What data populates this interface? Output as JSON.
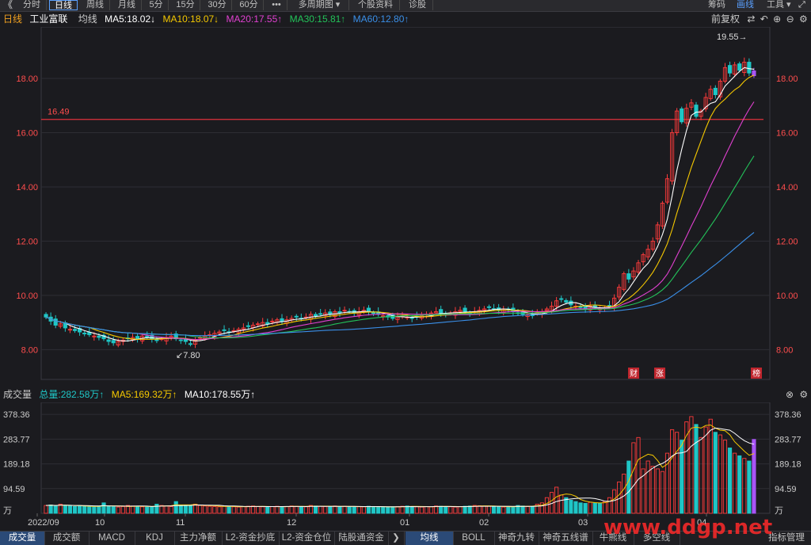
{
  "toolbar": {
    "back_glyph": "《",
    "periods": [
      "分时",
      "日线",
      "周线",
      "月线",
      "5分",
      "15分",
      "30分",
      "60分",
      "•••",
      "多周期图 ▾",
      "个股资料",
      "诊股"
    ],
    "active_period": "日线",
    "right_items": [
      "筹码",
      "画线",
      "工具 ▾"
    ],
    "icons": [
      "expand-icon"
    ]
  },
  "legend": {
    "period": "日线",
    "stock_name": "工业富联",
    "ma_label": "均线",
    "ma5": "MA5:18.02↓",
    "ma10": "MA10:18.07↓",
    "ma20": "MA20:17.55↑",
    "ma30": "MA30:15.81↑",
    "ma60": "MA60:12.80↑",
    "adjust": "前复权",
    "icons": [
      "swap-icon",
      "undo-icon",
      "zoom-in-icon",
      "zoom-out-icon",
      "settings-icon"
    ]
  },
  "volume_legend": {
    "title": "成交量",
    "total": "总量:282.58万↑",
    "ma5": "MA5:169.32万↑",
    "ma10": "MA10:178.55万↑"
  },
  "colors": {
    "up": "#ff3b3b",
    "down": "#1fc6c6",
    "ma5": "#ffffff",
    "ma10": "#f5c800",
    "ma20": "#e040d0",
    "ma30": "#23c35a",
    "ma60": "#3a8fe8",
    "last_bar": "#a855f7"
  },
  "chart_data": [
    {
      "type": "candlestick",
      "title": "工业富联 日线",
      "yticks": [
        "8.00",
        "10.00",
        "12.00",
        "14.00",
        "16.00",
        "18.00"
      ],
      "ylim": [
        6.9,
        19.9
      ],
      "xticks": [
        "2022/09",
        "10",
        "11",
        "12",
        "01",
        "02",
        "03",
        "04"
      ],
      "reference_line": {
        "label": "16.49",
        "value": 16.49
      },
      "annotations": [
        {
          "text": "19.55",
          "value": 19.55
        },
        {
          "text": "7.80",
          "value": 7.8
        }
      ],
      "badges": [
        "财",
        "涨",
        "榜"
      ],
      "n_bars": 148,
      "close": [
        9.2,
        9.05,
        8.9,
        8.95,
        8.8,
        8.75,
        8.7,
        8.65,
        8.6,
        8.55,
        8.5,
        8.45,
        8.4,
        8.3,
        8.25,
        8.3,
        8.35,
        8.4,
        8.45,
        8.4,
        8.5,
        8.45,
        8.4,
        8.35,
        8.4,
        8.45,
        8.5,
        8.4,
        8.35,
        8.3,
        8.2,
        8.35,
        8.45,
        8.5,
        8.55,
        8.6,
        8.65,
        8.7,
        8.65,
        8.7,
        8.75,
        8.8,
        8.85,
        8.9,
        8.95,
        9.0,
        8.95,
        9.05,
        9.1,
        9.05,
        9.1,
        9.15,
        9.2,
        9.15,
        9.2,
        9.3,
        9.25,
        9.3,
        9.35,
        9.3,
        9.4,
        9.35,
        9.45,
        9.4,
        9.35,
        9.4,
        9.45,
        9.4,
        9.35,
        9.3,
        9.25,
        9.2,
        9.15,
        9.2,
        9.25,
        9.2,
        9.15,
        9.2,
        9.25,
        9.3,
        9.35,
        9.4,
        9.35,
        9.3,
        9.35,
        9.4,
        9.45,
        9.4,
        9.35,
        9.4,
        9.45,
        9.5,
        9.55,
        9.5,
        9.45,
        9.5,
        9.45,
        9.4,
        9.35,
        9.3,
        9.3,
        9.25,
        9.35,
        9.4,
        9.5,
        9.6,
        9.8,
        9.85,
        9.75,
        9.65,
        9.6,
        9.55,
        9.5,
        9.6,
        9.55,
        9.5,
        9.55,
        9.6,
        9.9,
        10.3,
        10.8,
        10.6,
        10.9,
        11.2,
        11.5,
        11.7,
        12.0,
        12.6,
        13.4,
        14.3,
        16.0,
        16.8,
        16.4,
        16.9,
        17.1,
        16.6,
        16.8,
        17.3,
        17.6,
        17.4,
        17.9,
        18.4,
        18.2,
        18.5,
        18.3,
        18.6,
        18.2,
        18.1
      ],
      "volume_ylim": [
        0,
        400
      ],
      "volume_yticks": [
        "378.36",
        "283.77",
        "189.18",
        "94.59",
        "万"
      ],
      "volume": [
        30,
        32,
        28,
        35,
        30,
        28,
        26,
        30,
        27,
        25,
        24,
        28,
        40,
        26,
        25,
        24,
        26,
        30,
        28,
        27,
        25,
        24,
        26,
        35,
        30,
        28,
        26,
        45,
        32,
        30,
        28,
        35,
        30,
        28,
        27,
        26,
        25,
        28,
        26,
        25,
        24,
        26,
        27,
        28,
        26,
        25,
        24,
        26,
        27,
        25,
        26,
        28,
        27,
        26,
        25,
        30,
        28,
        27,
        26,
        25,
        28,
        26,
        27,
        25,
        24,
        26,
        25,
        27,
        26,
        25,
        24,
        23,
        25,
        26,
        27,
        28,
        26,
        25,
        24,
        26,
        25,
        28,
        27,
        26,
        25,
        24,
        26,
        27,
        28,
        30,
        29,
        28,
        27,
        26,
        25,
        24,
        26,
        25,
        30,
        28,
        26,
        27,
        35,
        40,
        60,
        80,
        100,
        70,
        60,
        50,
        45,
        40,
        38,
        42,
        40,
        38,
        45,
        60,
        90,
        120,
        150,
        200,
        270,
        290,
        170,
        200,
        180,
        170,
        160,
        230,
        320,
        310,
        280,
        350,
        370,
        340,
        290,
        330,
        360,
        310,
        300,
        280,
        250,
        230,
        220,
        210,
        200,
        282.58
      ]
    }
  ],
  "bottom_tabs": [
    "成交量",
    "成交额",
    "MACD",
    "KDJ",
    "主力净额",
    "L2-资金抄底",
    "L2-资金仓位",
    "陆股通资金",
    "均线",
    "BOLL",
    "神奇九转",
    "神奇五线谱",
    "牛熊线",
    "多空线",
    "指标管理"
  ],
  "active_bottom_tab": "成交量",
  "watermark": "www.ddgp.net"
}
